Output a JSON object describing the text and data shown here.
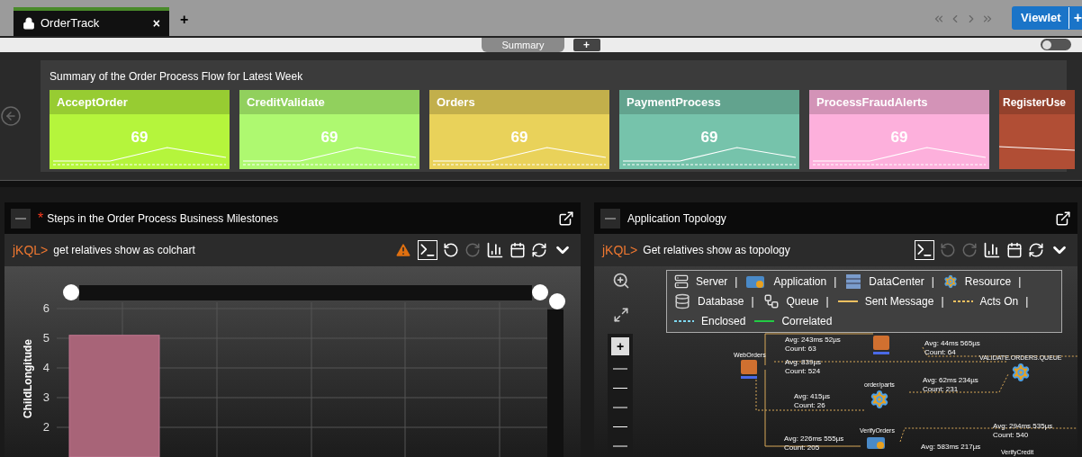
{
  "tabs": [
    {
      "label": "OrderTrack",
      "selected": true,
      "close": "×"
    }
  ],
  "add_tab": "+",
  "viewlet_button": {
    "label": "Viewlet",
    "plus": "+"
  },
  "sub_tabs": [
    {
      "label": "Summary",
      "selected": true
    }
  ],
  "summary_toggle": {
    "on": false
  },
  "summary": {
    "title": "Summary of the Order Process Flow for Latest Week",
    "cards": [
      {
        "name": "AcceptOrder",
        "value": "69",
        "color": "#b5f53c"
      },
      {
        "name": "CreditValidate",
        "value": "69",
        "color": "#aef970"
      },
      {
        "name": "Orders",
        "value": "69",
        "color": "#e9d25a"
      },
      {
        "name": "PaymentProcess",
        "value": "69",
        "color": "#76c3ab"
      },
      {
        "name": "ProcessFraudAlerts",
        "value": "69",
        "color": "#fdb0dc"
      },
      {
        "name": "RegisterUse",
        "color": "#b14e35"
      }
    ]
  },
  "left_panel": {
    "title": "Steps in the Order Process Business Milestones",
    "modified": "*",
    "prompt": "jKQL>",
    "query": "get relatives show as colchart",
    "warning": true,
    "chart_data": {
      "type": "bar",
      "ylabel": "ChildLongitude",
      "values": [
        5.1
      ],
      "yticks": [
        2,
        3,
        4,
        5,
        6
      ],
      "ylim": [
        1,
        6
      ],
      "grid": true
    }
  },
  "right_panel": {
    "title": "Application Topology",
    "prompt": "jKQL>",
    "query": "Get relatives show as topology",
    "warning": false,
    "legend": [
      {
        "label": "Server",
        "kind": "server",
        "sep": "|"
      },
      {
        "label": "Application",
        "kind": "application",
        "sep": "|"
      },
      {
        "label": "DataCenter",
        "kind": "datacenter",
        "sep": "|"
      },
      {
        "label": "Resource",
        "kind": "resource",
        "sep": "|"
      },
      {
        "label": "Database",
        "kind": "database",
        "sep": "|"
      },
      {
        "label": "Queue",
        "kind": "queue",
        "sep": "|"
      },
      {
        "label": "Sent Message",
        "kind": "line",
        "color": "#f0c060",
        "sep": "|"
      },
      {
        "label": "Acts On",
        "kind": "dashed",
        "color": "#f0c060",
        "sep": "|"
      },
      {
        "label": "Enclosed",
        "kind": "dashed",
        "color": "#7fd8f0"
      },
      {
        "label": "Correlated",
        "kind": "line",
        "color": "#22cc44"
      }
    ],
    "nodes": [
      {
        "label": "WebOrders",
        "kind": "start"
      },
      {
        "kind": "box"
      },
      {
        "label": "VALIDATE.ORDERS.QUEUE",
        "kind": "resource"
      },
      {
        "label": "order/parts",
        "kind": "resource"
      },
      {
        "label": "VerifyOrders",
        "kind": "application"
      },
      {
        "label": "VerifyCredit",
        "kind": "none"
      }
    ],
    "edge_labels": [
      {
        "avg": "Avg: 243ms 52µs",
        "count": "Count: 63"
      },
      {
        "avg": "Avg: 44ms 565µs",
        "count": "Count: 64"
      },
      {
        "avg": "Avg: 839µs",
        "count": "Count: 524"
      },
      {
        "avg": "Avg: 62ms 234µs",
        "count": "Count: 231"
      },
      {
        "avg": "Avg: 415µs",
        "count": "Count: 26"
      },
      {
        "avg": "Avg: 294ms 535µs",
        "count": "Count: 540"
      },
      {
        "avg": "Avg: 226ms 555µs",
        "count": "Count: 205"
      },
      {
        "avg": "Avg: 583ms 217µs"
      }
    ],
    "zoom": {
      "plus": "+"
    }
  }
}
